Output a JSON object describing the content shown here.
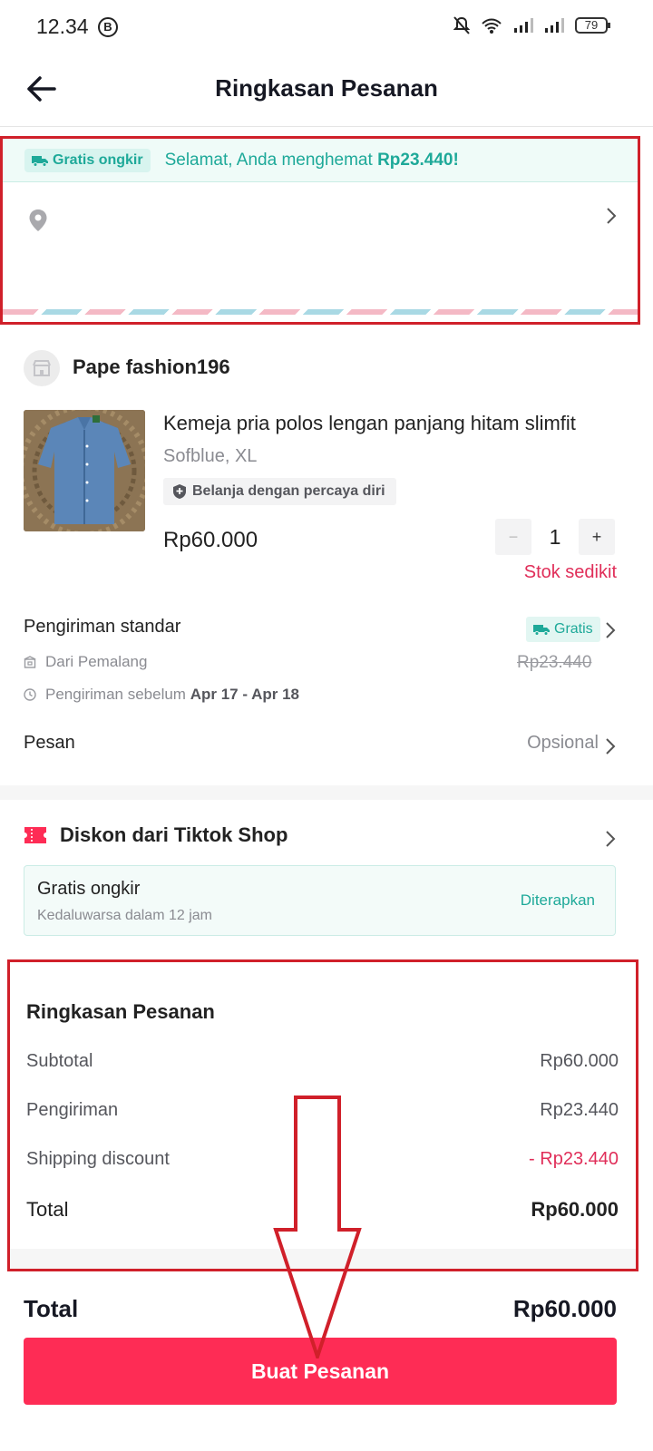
{
  "status_bar": {
    "time": "12.34",
    "b_badge": "B",
    "battery": "79"
  },
  "header": {
    "title": "Ringkasan Pesanan"
  },
  "address": {
    "chip_label": "Gratis ongkir",
    "banner_text": "Selamat, Anda menghemat ",
    "banner_amount": "Rp23.440!"
  },
  "shop": {
    "name": "Pape fashion196"
  },
  "product": {
    "title": "Kemeja pria polos lengan panjang hitam slimfit",
    "variant": "Sofblue, XL",
    "badge": "Belanja dengan percaya diri",
    "price": "Rp60.000",
    "qty_minus": "−",
    "quantity": "1",
    "qty_plus": "+",
    "stock_note": "Stok sedikit"
  },
  "shipping": {
    "label": "Pengiriman standar",
    "free_label": "Gratis",
    "from": "Dari Pemalang",
    "old_price": "Rp23.440",
    "eta_prefix": "Pengiriman sebelum ",
    "eta_dates": "Apr 17 - Apr 18"
  },
  "note": {
    "label": "Pesan",
    "value": "Opsional"
  },
  "discount": {
    "title": "Diskon dari Tiktok Shop",
    "card_title": "Gratis ongkir",
    "card_sub": "Kedaluwarsa dalam 12 jam",
    "card_status": "Diterapkan"
  },
  "summary": {
    "title": "Ringkasan Pesanan",
    "subtotal_label": "Subtotal",
    "subtotal_value": "Rp60.000",
    "shipping_label": "Pengiriman",
    "shipping_value": "Rp23.440",
    "discount_label": "Shipping discount",
    "discount_value": "- Rp23.440",
    "total_label": "Total",
    "total_value": "Rp60.000"
  },
  "footer": {
    "total_label": "Total",
    "total_value": "Rp60.000",
    "button_label": "Buat Pesanan"
  },
  "colors": {
    "accent": "#fe2c55",
    "teal": "#1ea999",
    "annotation_red": "#d0202a",
    "stock_pink": "#e02e59"
  }
}
